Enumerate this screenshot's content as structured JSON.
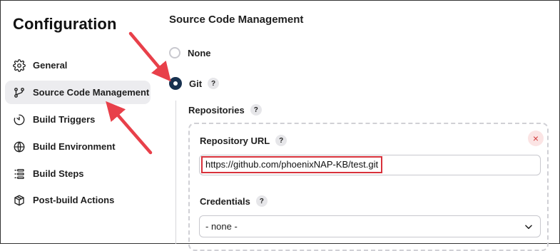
{
  "sidebar": {
    "title": "Configuration",
    "items": [
      {
        "label": "General",
        "icon": "gear-icon"
      },
      {
        "label": "Source Code Management",
        "icon": "git-branch-icon",
        "active": true
      },
      {
        "label": "Build Triggers",
        "icon": "timer-icon"
      },
      {
        "label": "Build Environment",
        "icon": "globe-icon"
      },
      {
        "label": "Build Steps",
        "icon": "list-icon"
      },
      {
        "label": "Post-build Actions",
        "icon": "package-icon"
      }
    ]
  },
  "main": {
    "section_title": "Source Code Management",
    "scm_options": [
      {
        "label": "None",
        "selected": false
      },
      {
        "label": "Git",
        "selected": true
      }
    ],
    "help_glyph": "?",
    "repositories_label": "Repositories",
    "repo": {
      "url_label": "Repository URL",
      "url_value": "https://github.com/phoenixNAP-KB/test.git",
      "close_glyph": "×",
      "credentials_label": "Credentials",
      "credentials_value": "- none -"
    }
  },
  "colors": {
    "accent_dark": "#17314f",
    "annotation_red": "#e8404a",
    "active_bg": "#ececef"
  }
}
